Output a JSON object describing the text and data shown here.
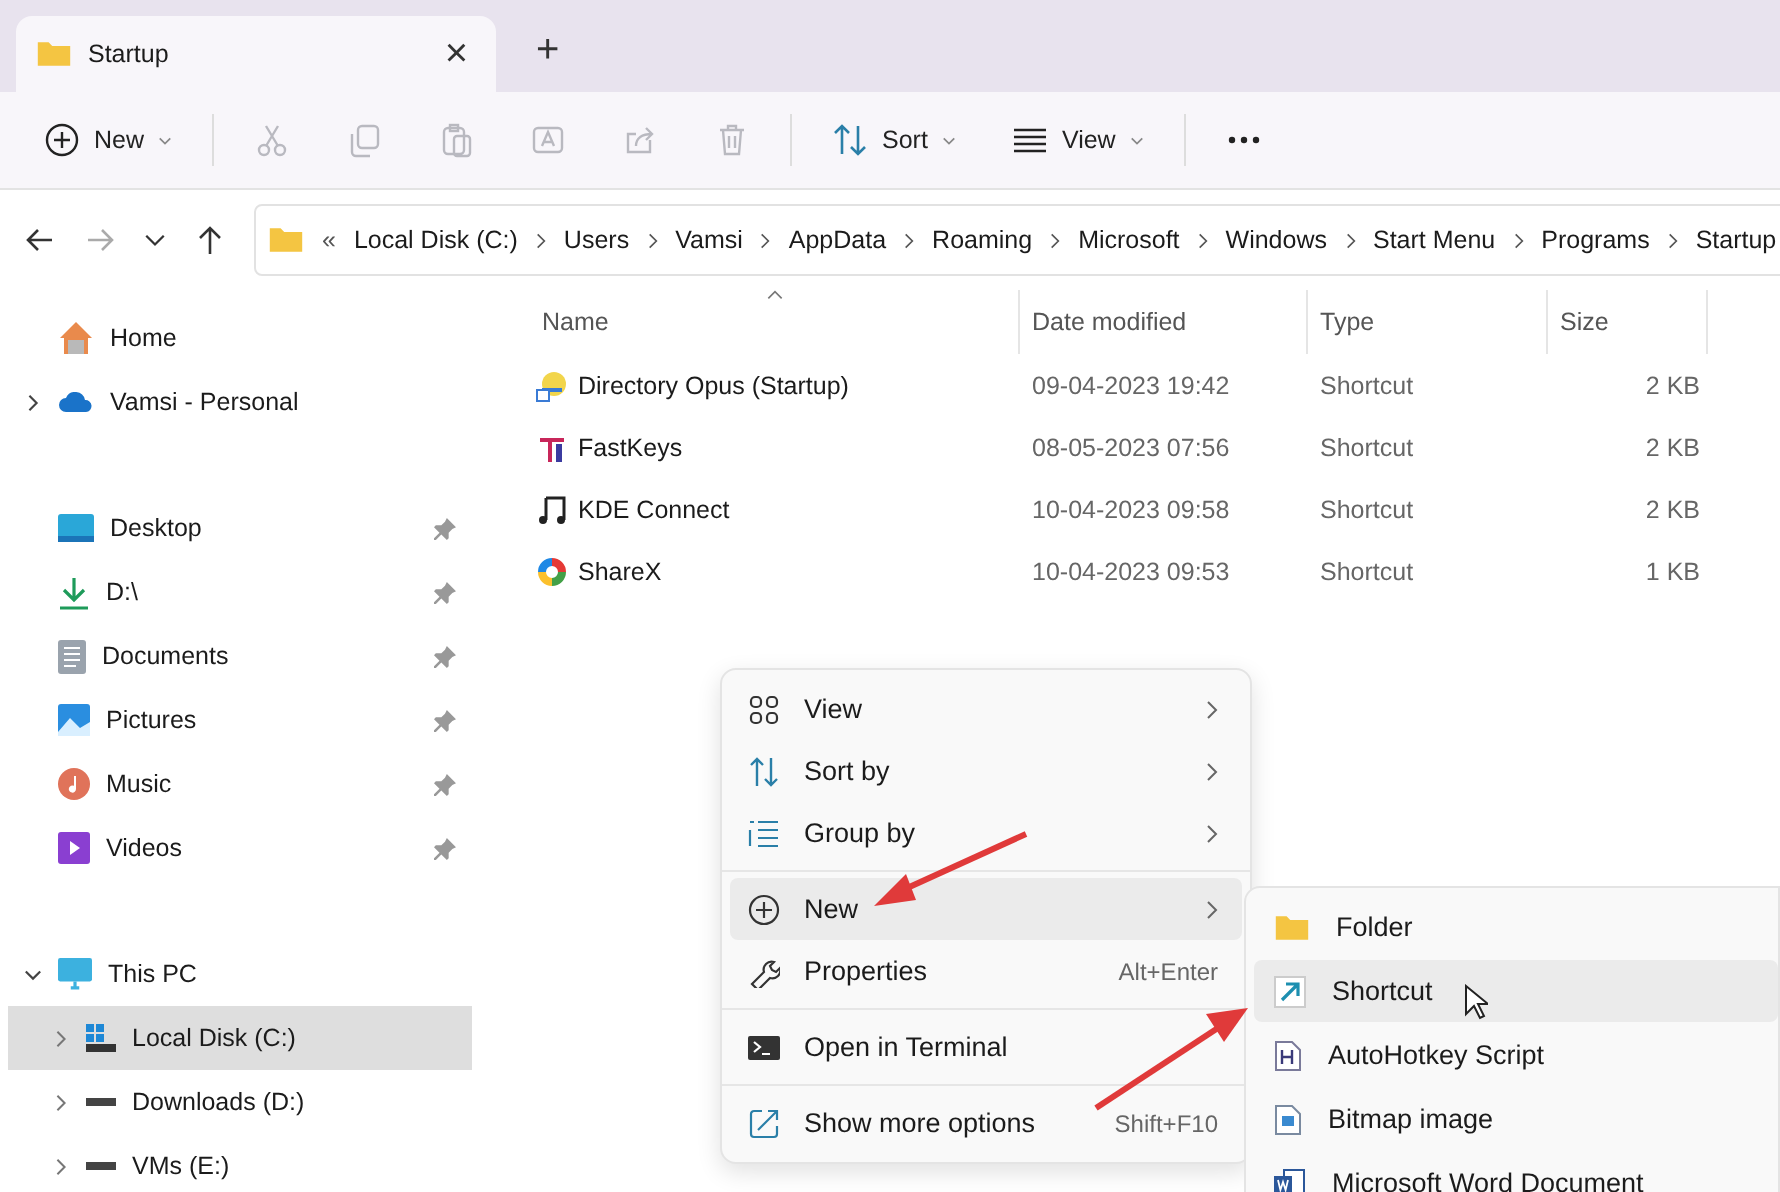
{
  "tab": {
    "title": "Startup",
    "close": "×",
    "new_tab": "+"
  },
  "toolbar": [
    {
      "kind": "new",
      "label": "New",
      "disabled": false
    },
    {
      "kind": "cut",
      "disabled": true
    },
    {
      "kind": "copy",
      "disabled": true
    },
    {
      "kind": "paste",
      "disabled": true
    },
    {
      "kind": "rename",
      "disabled": true
    },
    {
      "kind": "share",
      "disabled": true
    },
    {
      "kind": "delete",
      "disabled": true
    },
    {
      "kind": "sort",
      "label": "Sort",
      "disabled": false
    },
    {
      "kind": "view",
      "label": "View",
      "disabled": false
    },
    {
      "kind": "more",
      "disabled": false
    }
  ],
  "address": {
    "overflow": "«",
    "crumbs": [
      "Local Disk (C:)",
      "Users",
      "Vamsi",
      "AppData",
      "Roaming",
      "Microsoft",
      "Windows",
      "Start Menu",
      "Programs",
      "Startup"
    ]
  },
  "sidebar": {
    "groups": [
      [
        {
          "kind": "home",
          "label": "Home"
        },
        {
          "kind": "cloud",
          "label": "Vamsi - Personal",
          "expanded": false
        }
      ],
      [
        {
          "kind": "desktop",
          "label": "Desktop",
          "pinned": true
        },
        {
          "kind": "download",
          "label": "D:\\",
          "pinned": true
        },
        {
          "kind": "documents",
          "label": "Documents",
          "pinned": true
        },
        {
          "kind": "pictures",
          "label": "Pictures",
          "pinned": true
        },
        {
          "kind": "music",
          "label": "Music",
          "pinned": true
        },
        {
          "kind": "videos",
          "label": "Videos",
          "pinned": true
        }
      ],
      [
        {
          "kind": "pc",
          "label": "This PC",
          "expanded": true,
          "children": [
            {
              "kind": "disk",
              "label": "Local Disk (C:)",
              "expanded": false,
              "selected": true
            },
            {
              "kind": "drive",
              "label": "Downloads (D:)",
              "expanded": false,
              "selected": false
            },
            {
              "kind": "drive",
              "label": "VMs (E:)",
              "expanded": false,
              "selected": false
            }
          ]
        }
      ]
    ]
  },
  "table": {
    "columns": [
      "Name",
      "Date modified",
      "Type",
      "Size"
    ],
    "rows": [
      {
        "kind": "opus",
        "name": "Directory Opus (Startup)",
        "date": "09-04-2023 19:42",
        "type": "Shortcut",
        "size": "2 KB"
      },
      {
        "kind": "fastkeys",
        "name": "FastKeys",
        "date": "08-05-2023 07:56",
        "type": "Shortcut",
        "size": "2 KB"
      },
      {
        "kind": "kde",
        "name": "KDE Connect",
        "date": "10-04-2023 09:58",
        "type": "Shortcut",
        "size": "2 KB"
      },
      {
        "kind": "sharex",
        "name": "ShareX",
        "date": "10-04-2023 09:53",
        "type": "Shortcut",
        "size": "1 KB"
      }
    ]
  },
  "context_menu": {
    "groups": [
      [
        {
          "kind": "view",
          "label": "View",
          "submenu": true,
          "selected": false
        },
        {
          "kind": "sort",
          "label": "Sort by",
          "submenu": true,
          "selected": false
        },
        {
          "kind": "group",
          "label": "Group by",
          "submenu": true,
          "selected": false
        }
      ],
      [
        {
          "kind": "new",
          "label": "New",
          "submenu": true,
          "selected": true
        },
        {
          "kind": "properties",
          "label": "Properties",
          "shortcut": "Alt+Enter",
          "selected": false
        }
      ],
      [
        {
          "kind": "terminal",
          "label": "Open in Terminal",
          "selected": false
        }
      ],
      [
        {
          "kind": "more",
          "label": "Show more options",
          "shortcut": "Shift+F10",
          "selected": false
        }
      ]
    ]
  },
  "new_submenu": [
    {
      "kind": "folder",
      "label": "Folder",
      "selected": false
    },
    {
      "kind": "shortcut",
      "label": "Shortcut",
      "selected": true
    },
    {
      "kind": "ahk",
      "label": "AutoHotkey Script",
      "selected": false
    },
    {
      "kind": "bitmap",
      "label": "Bitmap image",
      "selected": false
    },
    {
      "kind": "word",
      "label": "Microsoft Word Document",
      "selected": false
    }
  ]
}
